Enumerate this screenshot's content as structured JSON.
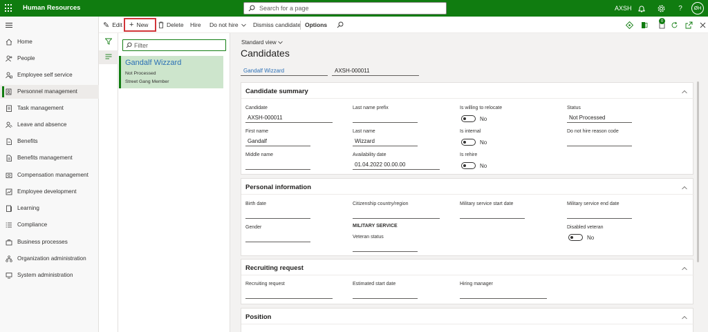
{
  "app": {
    "title": "Human Resources",
    "search_placeholder": "Search for a page",
    "company": "AXSH",
    "user_initials": "ØH",
    "brand_color": "#107c10"
  },
  "nav": {
    "items": [
      {
        "label": "Home",
        "icon": "home-icon"
      },
      {
        "label": "People",
        "icon": "people-icon"
      },
      {
        "label": "Employee self service",
        "icon": "person-icon"
      },
      {
        "label": "Personnel management",
        "icon": "personnel-icon"
      },
      {
        "label": "Task management",
        "icon": "task-icon"
      },
      {
        "label": "Leave and absence",
        "icon": "leave-icon"
      },
      {
        "label": "Benefits",
        "icon": "benefits-icon"
      },
      {
        "label": "Benefits management",
        "icon": "benefits-management-icon"
      },
      {
        "label": "Compensation management",
        "icon": "compensation-icon"
      },
      {
        "label": "Employee development",
        "icon": "development-icon"
      },
      {
        "label": "Learning",
        "icon": "learning-icon"
      },
      {
        "label": "Compliance",
        "icon": "compliance-icon"
      },
      {
        "label": "Business processes",
        "icon": "business-processes-icon"
      },
      {
        "label": "Organization administration",
        "icon": "organization-icon"
      },
      {
        "label": "System administration",
        "icon": "system-icon"
      }
    ],
    "active": "Personnel management"
  },
  "actions": {
    "edit": "Edit",
    "new": "New",
    "delete": "Delete",
    "hire": "Hire",
    "do_not_hire": "Do not hire",
    "dismiss": "Dismiss candidate",
    "options": "Options",
    "notification_count": "0"
  },
  "list": {
    "filter_placeholder": "Filter",
    "items": [
      {
        "name": "Gandalf Wizzard",
        "status": "Not Processed",
        "address": "Street Gang Member"
      }
    ]
  },
  "main": {
    "view": "Standard view",
    "title": "Candidates",
    "header_name": "Gandalf Wizzard",
    "header_id": "AXSH-000011",
    "summary": {
      "title": "Candidate summary",
      "candidate_label": "Candidate",
      "candidate_value": "AXSH-000011",
      "last_name_prefix_label": "Last name prefix",
      "last_name_prefix_value": "",
      "relocate_label": "Is willing to relocate",
      "relocate_value": "No",
      "status_label": "Status",
      "status_value": "Not Processed",
      "first_name_label": "First name",
      "first_name_value": "Gandalf",
      "last_name_label": "Last name",
      "last_name_value": "Wizzard",
      "internal_label": "Is internal",
      "internal_value": "No",
      "dnh_reason_label": "Do not hire reason code",
      "dnh_reason_value": "",
      "middle_name_label": "Middle name",
      "middle_name_value": "",
      "availability_label": "Availability date",
      "availability_value": "01.04.2022 00.00.00",
      "rehire_label": "Is rehire",
      "rehire_value": "No"
    },
    "personal": {
      "title": "Personal information",
      "birth_date_label": "Birth date",
      "citizenship_label": "Citizenship country/region",
      "military_start_label": "Military service start date",
      "military_end_label": "Military service end date",
      "gender_label": "Gender",
      "military_header": "MILITARY SERVICE",
      "veteran_status_label": "Veteran status",
      "disabled_veteran_label": "Disabled veteran",
      "disabled_veteran_value": "No"
    },
    "recruiting": {
      "title": "Recruiting request",
      "request_label": "Recruiting request",
      "start_date_label": "Estimated start date",
      "manager_label": "Hiring manager"
    },
    "position": {
      "title": "Position"
    }
  }
}
